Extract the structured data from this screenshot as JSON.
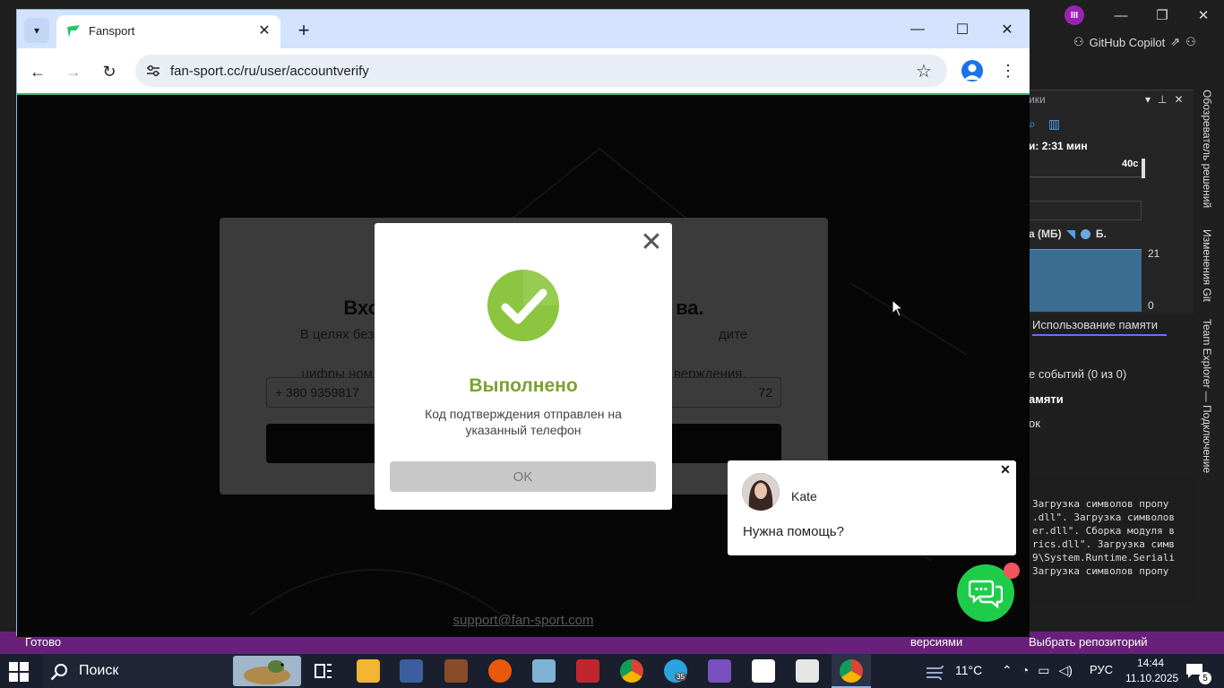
{
  "browser": {
    "tab_title": "Fansport",
    "url": "fan-sport.cc/ru/user/accountverify"
  },
  "page": {
    "verify_title_left": "Вхо",
    "verify_title_right": "ва.",
    "verify_text_line1_left": "В целях безопасно",
    "verify_text_line1_right": "дите недостающие",
    "verify_text_line2_left": "цифры ном",
    "verify_text_line2_right": "верждения.",
    "phone_prefix": "+ 380 9359817",
    "phone_suffix": "72",
    "support_email": "support@fan-sport.com"
  },
  "modal": {
    "close_label": "✕",
    "title": "Выполнено",
    "message": "Код подтверждения отправлен на указанный телефон",
    "ok_label": "OK",
    "title_color": "#7aa32e",
    "icon_color": "#8cc53f"
  },
  "chat": {
    "agent_name": "Kate",
    "message": "Нужна помощь?",
    "launcher_color": "#1fcc4a",
    "badge_color": "#f2545b"
  },
  "vs": {
    "avatar_initials": "III",
    "copilot_label": "GitHub Copilot",
    "panel_title": "ики",
    "diag_time": "и: 2:31 мин",
    "ruler_label": "40с",
    "mem_legend": "а (МБ)",
    "mem_legend_b": "Б.",
    "axis_max": "21",
    "axis_min": "0",
    "mem_tab": "Использование памяти",
    "events": "е событий (0 из 0)",
    "mem": "амяти",
    "ok": "ок",
    "output_lines": "Загрузка символов пропу\n.dll\". Загрузка символов\ner.dll\". Сборка модуля в\nrics.dll\". Загрузка симв\n9\\System.Runtime.Seriali\nЗагрузка символов пропу",
    "vtab_solution": "Обозреватель решений",
    "vtab_git": "Изменения Git",
    "vtab_team": "Team Explorer — Подключение",
    "status_ready": "Готово",
    "status_vc": "версиями",
    "status_repo": "Выбрать репозиторий",
    "status_color": "#68217a"
  },
  "taskbar": {
    "search_label": "Поиск",
    "temperature": "11°C",
    "language": "РУС",
    "time": "14:44",
    "date": "11.10.2025",
    "notification_count": "5",
    "telegram_badge": "35"
  }
}
